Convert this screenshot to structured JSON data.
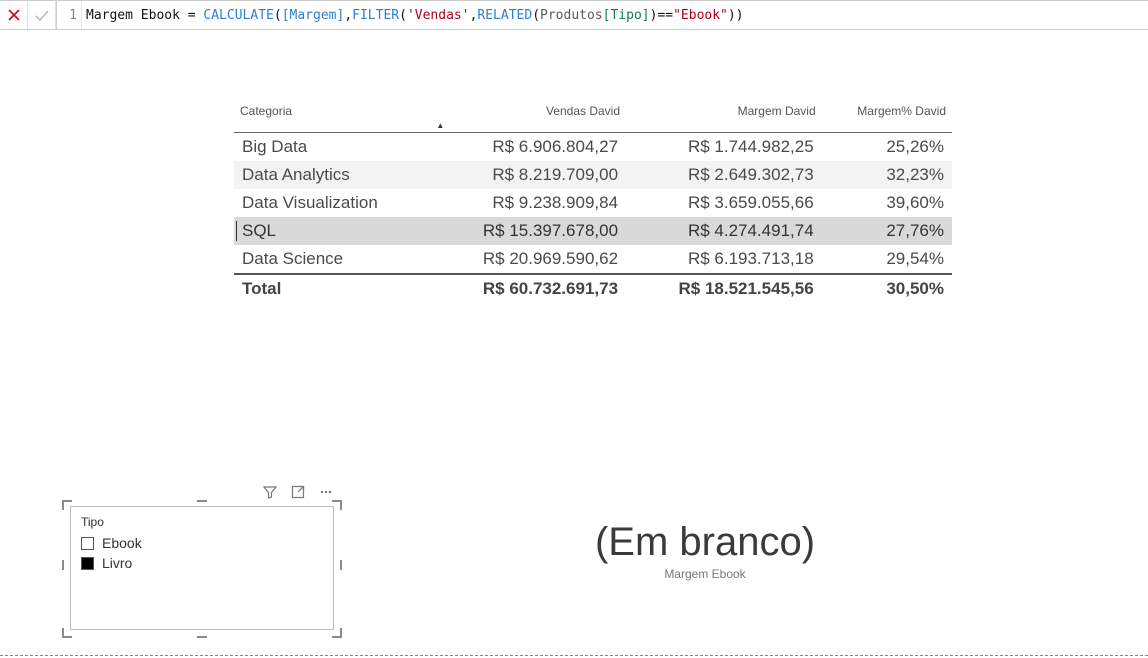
{
  "formula_bar": {
    "line_number": "1",
    "measure_name": "Margem Ebook",
    "tokens": {
      "calculate": "CALCULATE",
      "margem_ref": "[Margem]",
      "filter": "FILTER",
      "vendas_tbl": "'Vendas'",
      "related": "RELATED",
      "produtos_tbl": "Produtos",
      "tipo_col": "[Tipo]",
      "ebook_str": "\"Ebook\""
    }
  },
  "table": {
    "headers": {
      "categoria": "Categoria",
      "vendas": "Vendas David",
      "margem": "Margem David",
      "margem_pct": "Margem% David"
    },
    "rows": [
      {
        "categoria": "Big Data",
        "vendas": "R$ 6.906.804,27",
        "margem": "R$ 1.744.982,25",
        "margem_pct": "25,26%",
        "striped": false,
        "selected": false
      },
      {
        "categoria": "Data Analytics",
        "vendas": "R$ 8.219.709,00",
        "margem": "R$ 2.649.302,73",
        "margem_pct": "32,23%",
        "striped": true,
        "selected": false
      },
      {
        "categoria": "Data Visualization",
        "vendas": "R$ 9.238.909,84",
        "margem": "R$ 3.659.055,66",
        "margem_pct": "39,60%",
        "striped": false,
        "selected": false
      },
      {
        "categoria": "SQL",
        "vendas": "R$ 15.397.678,00",
        "margem": "R$ 4.274.491,74",
        "margem_pct": "27,76%",
        "striped": false,
        "selected": true
      },
      {
        "categoria": "Data Science",
        "vendas": "R$ 20.969.590,62",
        "margem": "R$ 6.193.713,18",
        "margem_pct": "29,54%",
        "striped": false,
        "selected": false
      }
    ],
    "total": {
      "label": "Total",
      "vendas": "R$ 60.732.691,73",
      "margem": "R$ 18.521.545,56",
      "margem_pct": "30,50%"
    },
    "sorted_column": "vendas",
    "sort_direction": "asc"
  },
  "slicer": {
    "title": "Tipo",
    "items": [
      {
        "label": "Ebook",
        "checked": false
      },
      {
        "label": "Livro",
        "checked": true
      }
    ]
  },
  "card": {
    "value": "(Em branco)",
    "label": "Margem Ebook"
  },
  "visual_toolbar": {
    "filter_tip": "Filtro",
    "focus_tip": "Modo de foco",
    "more_tip": "Mais opções"
  }
}
